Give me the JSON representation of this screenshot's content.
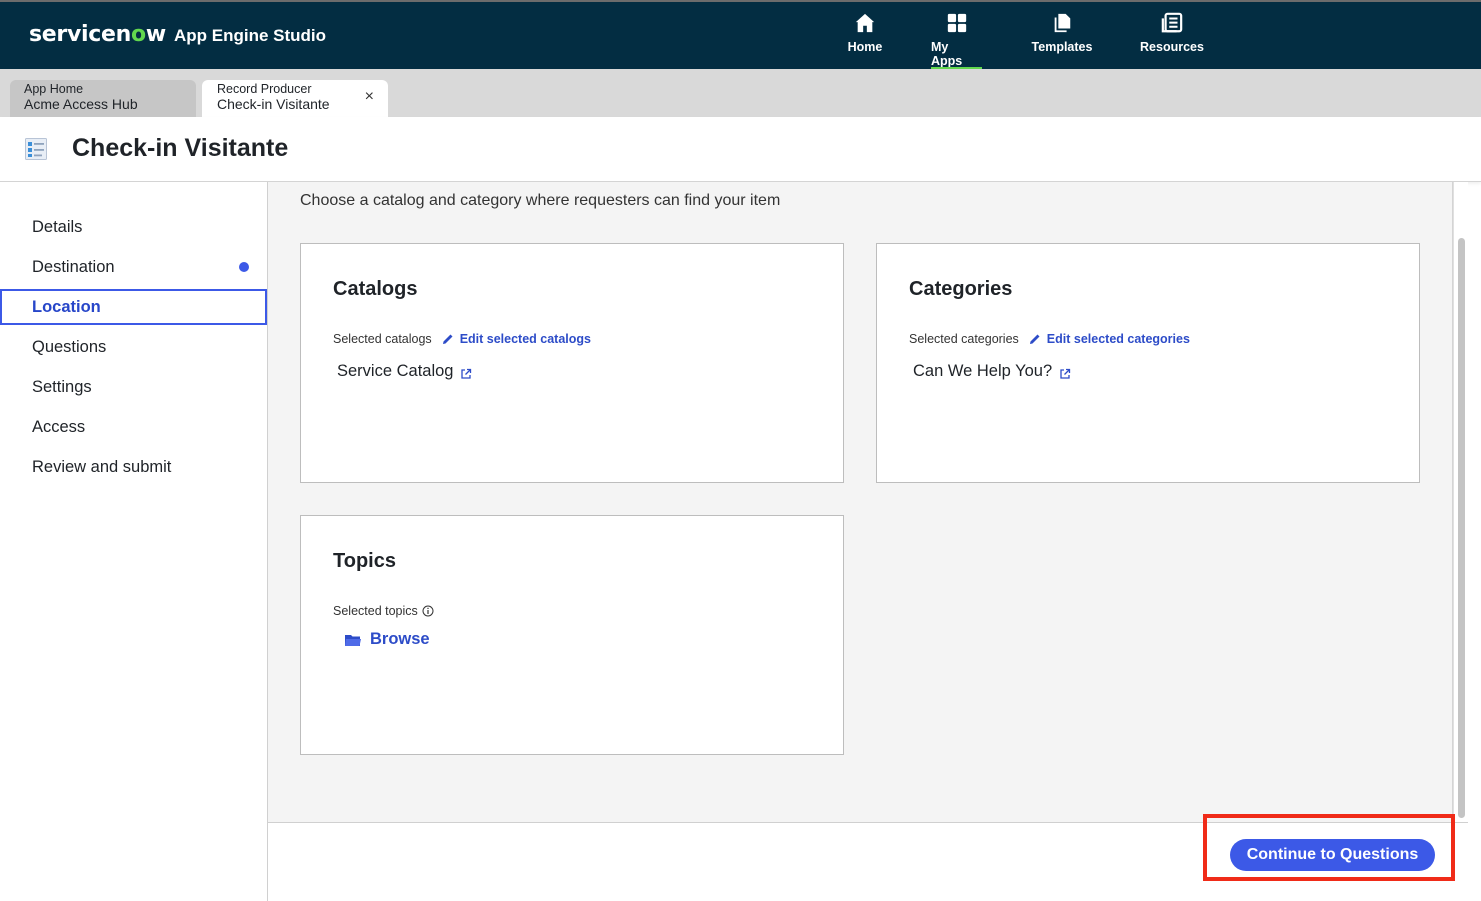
{
  "header": {
    "brand_prefix": "servicen",
    "brand_o": "o",
    "brand_suffix": "w",
    "studio": "App Engine Studio",
    "nav": [
      {
        "label": "Home",
        "icon": "home-icon"
      },
      {
        "label": "My Apps",
        "icon": "grid-icon",
        "active": true
      },
      {
        "label": "Templates",
        "icon": "templates-icon"
      },
      {
        "label": "Resources",
        "icon": "resources-icon"
      }
    ],
    "accent_color": "#62d84e",
    "bg_color": "#032d42"
  },
  "tabs": [
    {
      "line1": "App Home",
      "line2": "Acme Access Hub"
    },
    {
      "line1": "Record Producer",
      "line2": "Check-in Visitante",
      "active": true,
      "close": "×"
    }
  ],
  "page": {
    "title": "Check-in Visitante",
    "icon": "record-producer-icon"
  },
  "sidebar": {
    "items": [
      {
        "label": "Details"
      },
      {
        "label": "Destination",
        "status_dot": true
      },
      {
        "label": "Location",
        "active": true
      },
      {
        "label": "Questions"
      },
      {
        "label": "Settings"
      },
      {
        "label": "Access"
      },
      {
        "label": "Review and submit"
      }
    ]
  },
  "main": {
    "subtitle": "Choose a catalog and category where requesters can find your item",
    "catalogs": {
      "title": "Catalogs",
      "selected_label": "Selected catalogs",
      "edit_label": "Edit selected catalogs",
      "value": "Service Catalog"
    },
    "categories": {
      "title": "Categories",
      "selected_label": "Selected categories",
      "edit_label": "Edit selected categories",
      "value": "Can We Help You?"
    },
    "topics": {
      "title": "Topics",
      "selected_label": "Selected topics",
      "browse_label": "Browse"
    }
  },
  "footer": {
    "continue_label": "Continue to Questions",
    "button_color": "#3c59e7",
    "highlight_color": "#f02b18"
  }
}
